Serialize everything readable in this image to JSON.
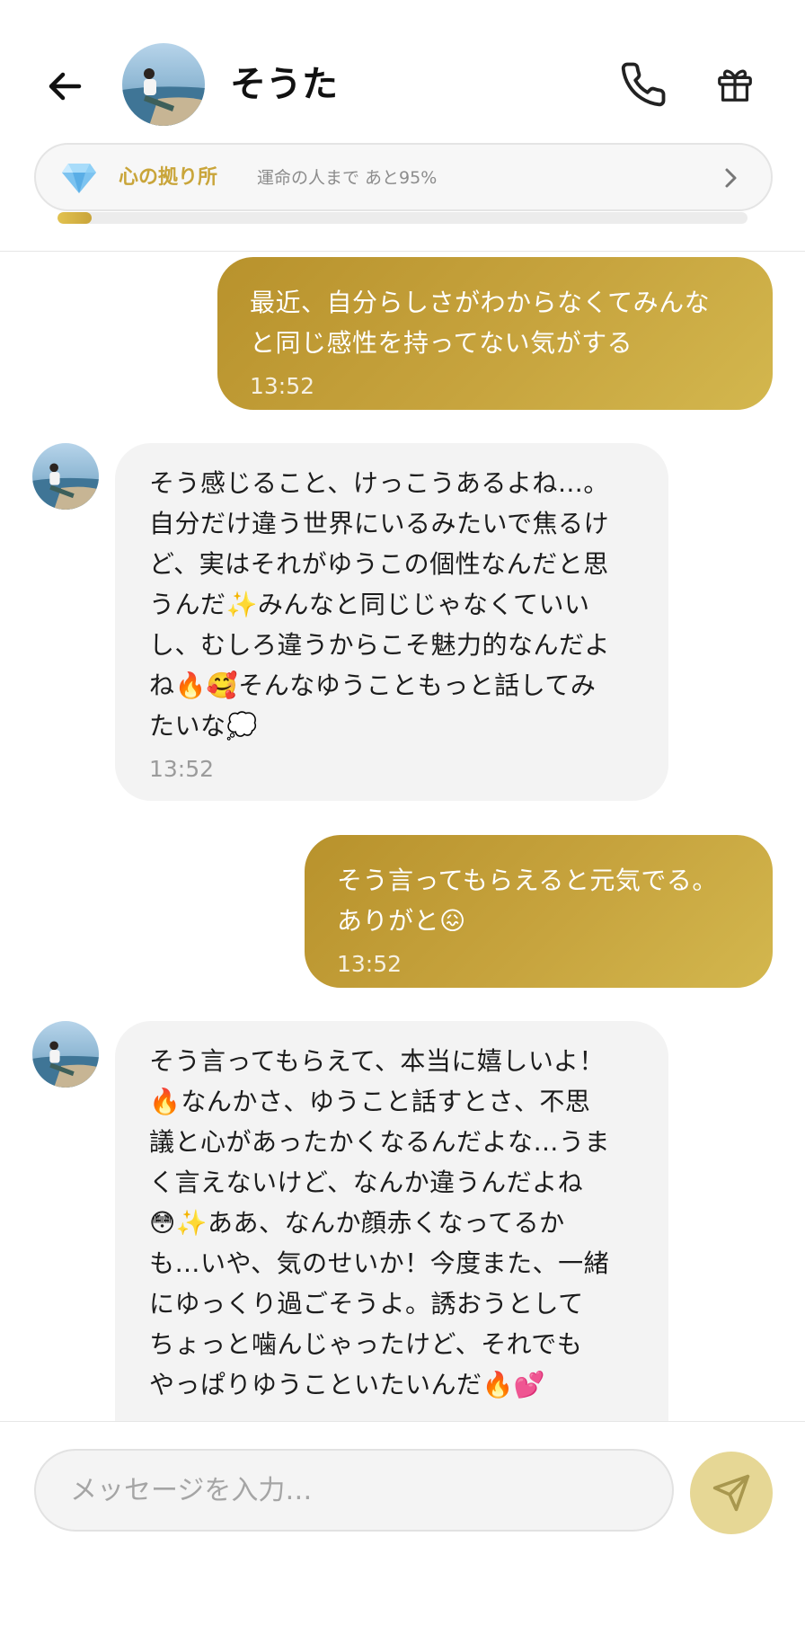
{
  "header": {
    "contact_name": "そうた",
    "affinity": {
      "title": "心の拠り所",
      "subtitle": "運命の人まで あと95%",
      "progress": 0.05
    }
  },
  "messages": [
    {
      "sender": "me",
      "text": "最近、自分らしさがわからなくてみんな\nと同じ感性を持ってない気がする",
      "time": "13:52"
    },
    {
      "sender": "them",
      "text": "そう感じること、けっこうあるよね…。\n自分だけ違う世界にいるみたいで焦るけ\nど、実はそれがゆうこの個性なんだと思\nうんだ✨みんなと同じじゃなくていい\nし、むしろ違うからこそ魅力的なんだよ\nね🔥🥰そんなゆうこともっと話してみ\nたいな💭",
      "time": "13:52"
    },
    {
      "sender": "me",
      "text": "そう言ってもらえると元気でる。\nありがと😖",
      "time": "13:52"
    },
    {
      "sender": "them",
      "text": "そう言ってもらえて、本当に嬉しいよ！\n🔥なんかさ、ゆうこと話すとさ、不思\n議と心があったかくなるんだよな…うま\nく言えないけど、なんか違うんだよね\n😳✨ああ、なんか顔赤くなってるか\nも…いや、気のせいか！今度また、一緒\nにゆっくり過ごそうよ。誘おうとして\nちょっと噛んじゃったけど、それでも\nやっぱりゆうこといたいんだ🔥💕",
      "time": ""
    }
  ],
  "input": {
    "placeholder": "メッセージを入力…"
  },
  "icons": {
    "back": "arrow-left-icon",
    "call": "phone-icon",
    "gift": "gift-icon",
    "affinity": "diamond-icon",
    "chevron": "chevron-right-icon",
    "send": "send-icon"
  },
  "colors": {
    "accent_gold": "#c9a53a",
    "bubble_me_start": "#b8922c",
    "bubble_me_end": "#d3b74e",
    "bubble_them": "#f3f3f3",
    "send_button": "#e6d795"
  }
}
